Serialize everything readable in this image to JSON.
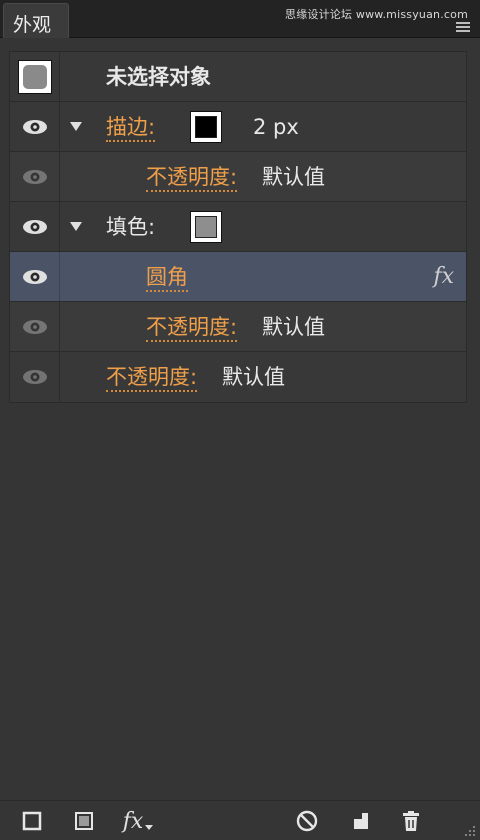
{
  "panel": {
    "tab_label": "外观",
    "watermark": "思缘设计论坛 www.missyuan.com"
  },
  "rows": [
    {
      "type": "object",
      "label": "未选择对象"
    },
    {
      "type": "stroke",
      "label": "描边:",
      "value": "2 px"
    },
    {
      "type": "opacity",
      "label": "不透明度:",
      "value": "默认值"
    },
    {
      "type": "fill",
      "label": "填色:"
    },
    {
      "type": "effect",
      "label": "圆角",
      "fx": "fx"
    },
    {
      "type": "opacity",
      "label": "不透明度:",
      "value": "默认值"
    },
    {
      "type": "opacity",
      "label": "不透明度:",
      "value": "默认值"
    }
  ],
  "toolbar": {
    "fx_label": "fx"
  },
  "colors": {
    "accent_link": "#f0a04a",
    "selected_row": "#4b5366",
    "panel_bg": "#353535"
  },
  "icons": [
    "eye-icon",
    "disclosure-triangle-icon",
    "add-new-stroke-icon",
    "add-new-fill-icon",
    "add-new-effect-icon",
    "clear-appearance-icon",
    "duplicate-item-icon",
    "delete-item-icon",
    "panel-menu-icon"
  ]
}
